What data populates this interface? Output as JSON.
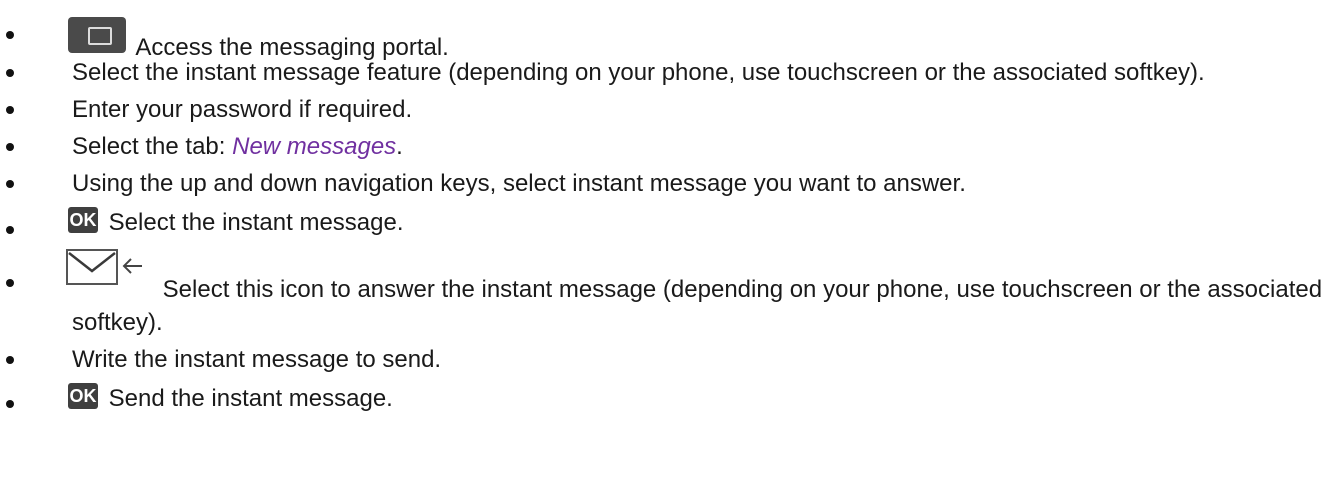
{
  "steps": [
    {
      "icon": "mail-key-icon",
      "text": "Access the messaging portal."
    },
    {
      "text": "Select the instant message feature (depending on your phone, use touchscreen or the associated softkey)."
    },
    {
      "text": "Enter your password if required."
    },
    {
      "prefix": "Select the tab: ",
      "emphasis": "New messages",
      "suffix": "."
    },
    {
      "text": "Using the up and down navigation keys, select instant message you want to answer."
    },
    {
      "icon": "ok-key-icon",
      "icon_text": "OK",
      "text": "Select the instant message."
    },
    {
      "icon": "reply-mail-icon",
      "text": "Select this icon to answer the instant message (depending on your phone, use touchscreen or the associated softkey)."
    },
    {
      "text": "Write the instant message to send."
    },
    {
      "icon": "ok-key-icon",
      "icon_text": "OK",
      "text": "Send the instant message."
    }
  ]
}
